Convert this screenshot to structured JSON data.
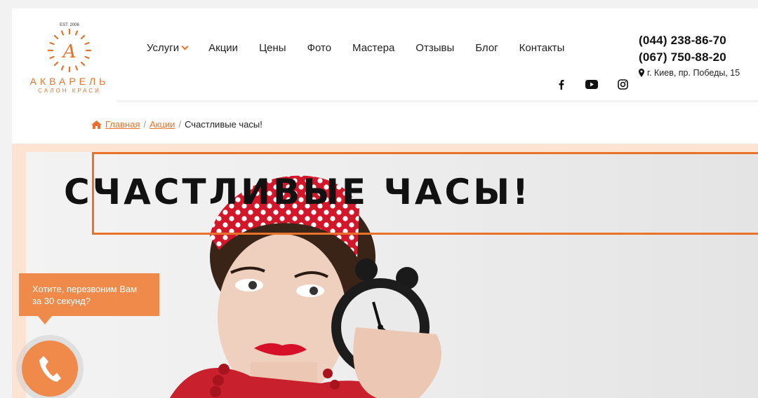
{
  "brand": {
    "est": "EST. 2006",
    "name": "АКВАРЕЛЬ",
    "tagline": "САЛОН КРАСИ",
    "accent": "#e8722c"
  },
  "nav": {
    "items": [
      {
        "label": "Услуги",
        "has_dropdown": true
      },
      {
        "label": "Акции"
      },
      {
        "label": "Цены"
      },
      {
        "label": "Фото"
      },
      {
        "label": "Мастера"
      },
      {
        "label": "Отзывы"
      },
      {
        "label": "Блог"
      },
      {
        "label": "Контакты"
      }
    ]
  },
  "social": [
    "facebook-icon",
    "youtube-icon",
    "instagram-icon"
  ],
  "contacts": {
    "phone1": "(044) 238-86-70",
    "phone2": "(067) 750-88-20",
    "address": "г. Киев, пр. Победы, 15"
  },
  "breadcrumb": {
    "home": "Главная",
    "section": "Акции",
    "current": "Счастливые часы!",
    "separator": "/"
  },
  "hero": {
    "title": "СЧАСТЛИВЫЕ ЧАСЫ!"
  },
  "callback": {
    "text": "Хотите, перезвоним Вам за 30 секунд?",
    "color": "#ef8a4a"
  }
}
